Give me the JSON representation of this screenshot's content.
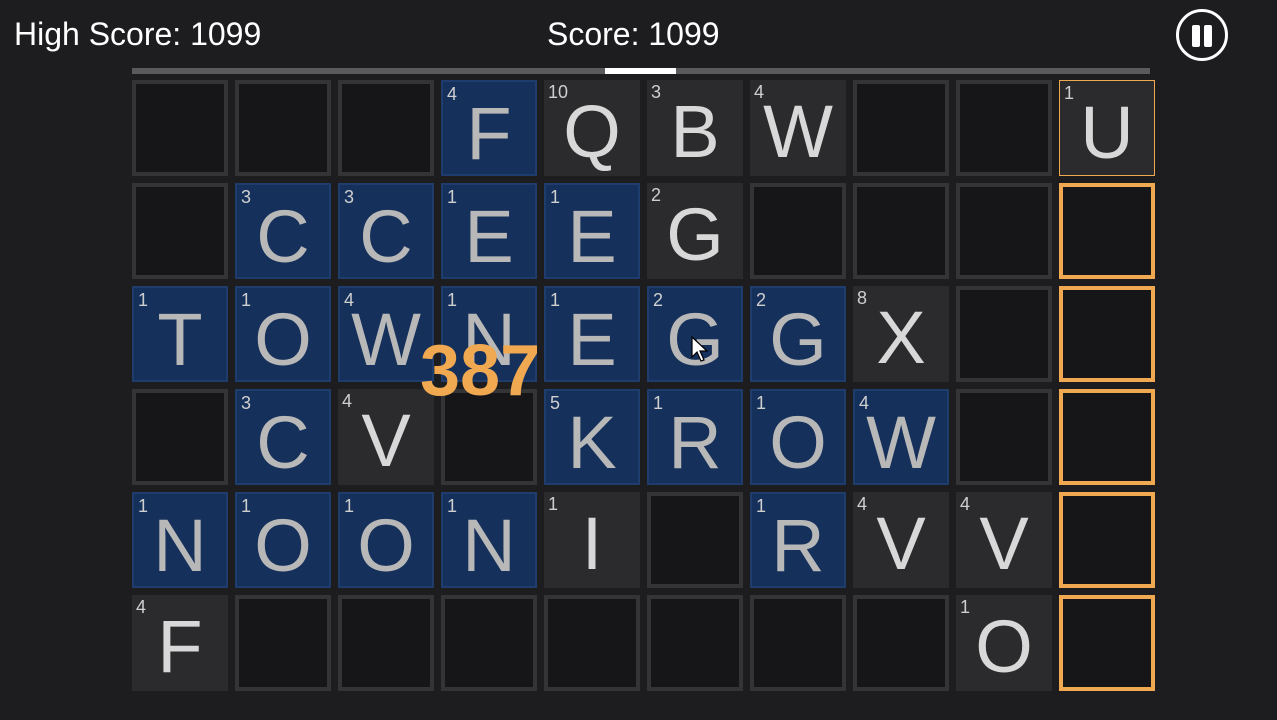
{
  "hud": {
    "high_score": "High Score: 1099",
    "score": "Score: 1099",
    "pause_icon": "pause-icon"
  },
  "progress": 0.07,
  "combo": "387",
  "colors": {
    "background": "#1d1d1f",
    "selected_tile": "#15305a",
    "target_outline": "#f0a851",
    "combo_text": "#f0a851"
  },
  "board": {
    "columns": 10,
    "rows": 6,
    "cells": [
      [
        {
          "state": "empty"
        },
        {
          "state": "empty"
        },
        {
          "state": "empty"
        },
        {
          "state": "selected",
          "letter": "F",
          "points": "4"
        },
        {
          "state": "letter",
          "letter": "Q",
          "points": "10"
        },
        {
          "state": "letter",
          "letter": "B",
          "points": "3"
        },
        {
          "state": "letter",
          "letter": "W",
          "points": "4"
        },
        {
          "state": "empty"
        },
        {
          "state": "empty"
        },
        {
          "state": "target-letter",
          "letter": "U",
          "points": "1"
        }
      ],
      [
        {
          "state": "empty"
        },
        {
          "state": "selected",
          "letter": "C",
          "points": "3"
        },
        {
          "state": "selected",
          "letter": "C",
          "points": "3"
        },
        {
          "state": "selected",
          "letter": "E",
          "points": "1"
        },
        {
          "state": "selected",
          "letter": "E",
          "points": "1"
        },
        {
          "state": "letter",
          "letter": "G",
          "points": "2"
        },
        {
          "state": "empty"
        },
        {
          "state": "empty"
        },
        {
          "state": "empty"
        },
        {
          "state": "target"
        }
      ],
      [
        {
          "state": "selected",
          "letter": "T",
          "points": "1"
        },
        {
          "state": "selected",
          "letter": "O",
          "points": "1"
        },
        {
          "state": "selected",
          "letter": "W",
          "points": "4"
        },
        {
          "state": "selected",
          "letter": "N",
          "points": "1"
        },
        {
          "state": "selected",
          "letter": "E",
          "points": "1"
        },
        {
          "state": "selected",
          "letter": "G",
          "points": "2"
        },
        {
          "state": "selected",
          "letter": "G",
          "points": "2"
        },
        {
          "state": "letter",
          "letter": "X",
          "points": "8"
        },
        {
          "state": "empty"
        },
        {
          "state": "target"
        }
      ],
      [
        {
          "state": "empty"
        },
        {
          "state": "selected",
          "letter": "C",
          "points": "3"
        },
        {
          "state": "letter",
          "letter": "V",
          "points": "4"
        },
        {
          "state": "empty"
        },
        {
          "state": "selected",
          "letter": "K",
          "points": "5"
        },
        {
          "state": "selected",
          "letter": "R",
          "points": "1"
        },
        {
          "state": "selected",
          "letter": "O",
          "points": "1"
        },
        {
          "state": "selected",
          "letter": "W",
          "points": "4"
        },
        {
          "state": "empty"
        },
        {
          "state": "target"
        }
      ],
      [
        {
          "state": "selected",
          "letter": "N",
          "points": "1"
        },
        {
          "state": "selected",
          "letter": "O",
          "points": "1"
        },
        {
          "state": "selected",
          "letter": "O",
          "points": "1"
        },
        {
          "state": "selected",
          "letter": "N",
          "points": "1"
        },
        {
          "state": "letter",
          "letter": "I",
          "points": "1"
        },
        {
          "state": "empty"
        },
        {
          "state": "selected",
          "letter": "R",
          "points": "1"
        },
        {
          "state": "letter",
          "letter": "V",
          "points": "4"
        },
        {
          "state": "letter",
          "letter": "V",
          "points": "4"
        },
        {
          "state": "target"
        }
      ],
      [
        {
          "state": "letter",
          "letter": "F",
          "points": "4"
        },
        {
          "state": "empty"
        },
        {
          "state": "empty"
        },
        {
          "state": "empty"
        },
        {
          "state": "empty"
        },
        {
          "state": "empty"
        },
        {
          "state": "empty"
        },
        {
          "state": "empty"
        },
        {
          "state": "letter",
          "letter": "O",
          "points": "1"
        },
        {
          "state": "target"
        }
      ]
    ]
  },
  "cursor_icon": "mouse-pointer-icon"
}
